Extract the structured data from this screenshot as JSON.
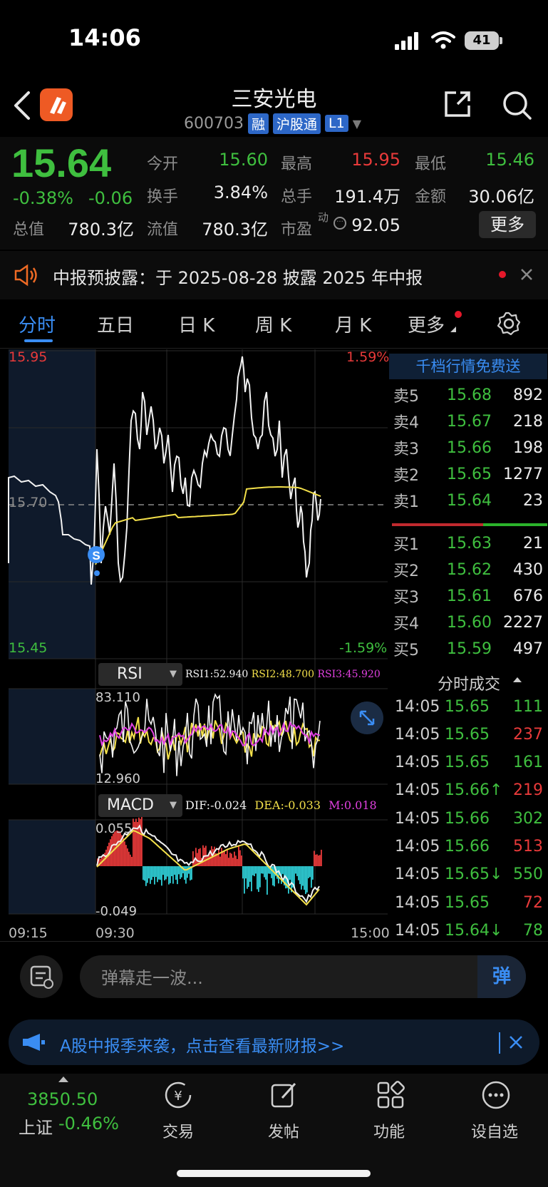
{
  "status_bar": {
    "time": "14:06",
    "battery": "41"
  },
  "header": {
    "title": "三安光电",
    "code": "600703",
    "tags": [
      "融",
      "沪股通",
      "L1"
    ]
  },
  "quote": {
    "price": "15.64",
    "change_pct": "-0.38%",
    "change": "-0.06",
    "fields": [
      {
        "label": "今开",
        "value": "15.60",
        "color": "#3fbf3f"
      },
      {
        "label": "最高",
        "value": "15.95",
        "color": "#e83a3a"
      },
      {
        "label": "最低",
        "value": "15.46",
        "color": "#3fbf3f"
      },
      {
        "label": "换手",
        "value": "3.84%",
        "color": "#ececec"
      },
      {
        "label": "总手",
        "value": "191.4万",
        "color": "#ececec"
      },
      {
        "label": "金额",
        "value": "30.06亿",
        "color": "#ececec"
      },
      {
        "label": "总值",
        "value": "780.3亿",
        "color": "#ececec"
      },
      {
        "label": "流值",
        "value": "780.3亿",
        "color": "#ececec"
      },
      {
        "label": "市盈",
        "value": "92.05",
        "color": "#ececec"
      }
    ],
    "pe_superscript": "动",
    "more_label": "更多"
  },
  "notice": {
    "text": "中报预披露：于 2025-08-28 披露 2025 年中报"
  },
  "tabs": [
    "分时",
    "五日",
    "日 K",
    "周 K",
    "月 K",
    "更多"
  ],
  "chart": {
    "price_high": "15.95",
    "price_low": "15.45",
    "pct_high": "1.59%",
    "pct_low": "-1.59%",
    "mid_label": "15.70",
    "rsi": {
      "name": "RSI",
      "rsi1": "RSI1:52.940",
      "rsi2": "RSI2:48.700",
      "rsi3": "RSI3:45.920",
      "max": "83.110",
      "min": "12.960"
    },
    "macd": {
      "name": "MACD",
      "dif": "DIF:-0.024",
      "dea": "DEA:-0.033",
      "m": "M:0.018",
      "max": "0.055",
      "min": "-0.049"
    },
    "time_labels": [
      "09:15",
      "09:30",
      "15:00"
    ],
    "marker": "S"
  },
  "order_book": {
    "header": "千档行情免费送",
    "asks": [
      {
        "label": "卖5",
        "price": "15.68",
        "vol": "892"
      },
      {
        "label": "卖4",
        "price": "15.67",
        "vol": "218"
      },
      {
        "label": "卖3",
        "price": "15.66",
        "vol": "198"
      },
      {
        "label": "卖2",
        "price": "15.65",
        "vol": "1277"
      },
      {
        "label": "卖1",
        "price": "15.64",
        "vol": "23"
      }
    ],
    "bids": [
      {
        "label": "买1",
        "price": "15.63",
        "vol": "21"
      },
      {
        "label": "买2",
        "price": "15.62",
        "vol": "430"
      },
      {
        "label": "买3",
        "price": "15.61",
        "vol": "676"
      },
      {
        "label": "买4",
        "price": "15.60",
        "vol": "2227"
      },
      {
        "label": "买5",
        "price": "15.59",
        "vol": "497"
      }
    ]
  },
  "trades": {
    "header": "分时成交",
    "rows": [
      {
        "time": "14:05",
        "price": "15.65",
        "vol": "111",
        "vol_color": "#3fbf3f"
      },
      {
        "time": "14:05",
        "price": "15.65",
        "vol": "237",
        "vol_color": "#e83a3a"
      },
      {
        "time": "14:05",
        "price": "15.65",
        "vol": "161",
        "vol_color": "#3fbf3f"
      },
      {
        "time": "14:05",
        "price": "15.66↑",
        "vol": "219",
        "vol_color": "#e83a3a"
      },
      {
        "time": "14:05",
        "price": "15.66",
        "vol": "302",
        "vol_color": "#3fbf3f"
      },
      {
        "time": "14:05",
        "price": "15.66",
        "vol": "513",
        "vol_color": "#e83a3a"
      },
      {
        "time": "14:05",
        "price": "15.65↓",
        "vol": "550",
        "vol_color": "#3fbf3f"
      },
      {
        "time": "14:05",
        "price": "15.65",
        "vol": "72",
        "vol_color": "#e83a3a"
      },
      {
        "time": "14:05",
        "price": "15.64↓",
        "vol": "78",
        "vol_color": "#3fbf3f"
      }
    ]
  },
  "comment": {
    "placeholder": "弹幕走一波...",
    "danmu_label": "弹"
  },
  "banner": {
    "text": "A股中报季来袭，点击查看最新财报>>"
  },
  "bottom_nav": {
    "index_value": "3850.50",
    "index_name": "上证",
    "index_change": "-0.46%",
    "items": [
      "交易",
      "发帖",
      "功能",
      "设自选"
    ]
  }
}
